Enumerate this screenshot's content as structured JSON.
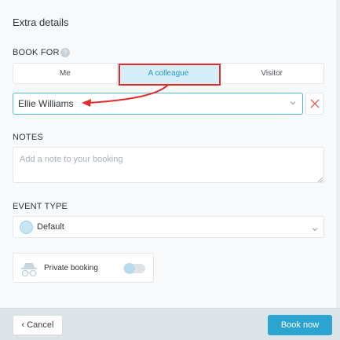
{
  "header": {
    "title": "Extra details"
  },
  "book_for": {
    "label": "BOOK FOR",
    "options": [
      "Me",
      "A colleague",
      "Visitor"
    ],
    "selected": "A colleague"
  },
  "colleague": {
    "value": "Ellie Williams"
  },
  "notes": {
    "label": "NOTES",
    "placeholder": "Add a note to your booking"
  },
  "event_type": {
    "label": "EVENT TYPE",
    "value": "Default",
    "dot_color": "#c6e6f4"
  },
  "private_booking": {
    "label": "Private booking",
    "enabled": false
  },
  "footer": {
    "cancel_label": "Cancel",
    "book_label": "Book now"
  },
  "colors": {
    "accent": "#2ba5cf",
    "annotation": "#e02d2d"
  }
}
